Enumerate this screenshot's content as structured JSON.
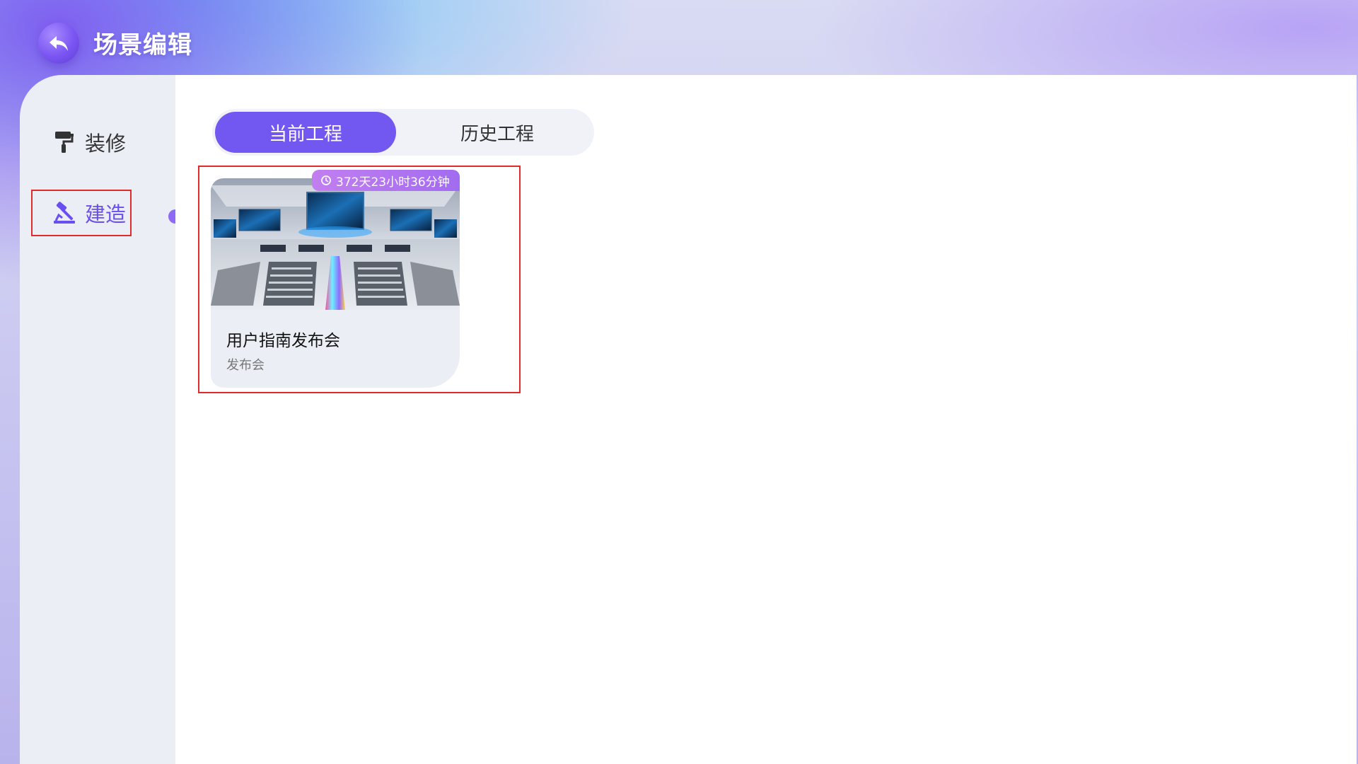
{
  "header": {
    "title": "场景编辑",
    "back_icon": "back-arrow-icon"
  },
  "sidebar": {
    "items": [
      {
        "label": "装修",
        "icon": "paint-roller-icon",
        "active": false
      },
      {
        "label": "建造",
        "icon": "hammer-icon",
        "active": true
      }
    ]
  },
  "tabs": [
    {
      "label": "当前工程",
      "active": true
    },
    {
      "label": "历史工程",
      "active": false
    }
  ],
  "projects": [
    {
      "title": "用户指南发布会",
      "category": "发布会",
      "remaining_time": "372天23小时36分钟",
      "thumbnail": "virtual-conference-hall-thumbnail"
    }
  ],
  "colors": {
    "accent": "#7257f0",
    "badge": "#b175f0",
    "highlight_box": "#e12b2b",
    "sidebar_bg": "#eceef5"
  }
}
